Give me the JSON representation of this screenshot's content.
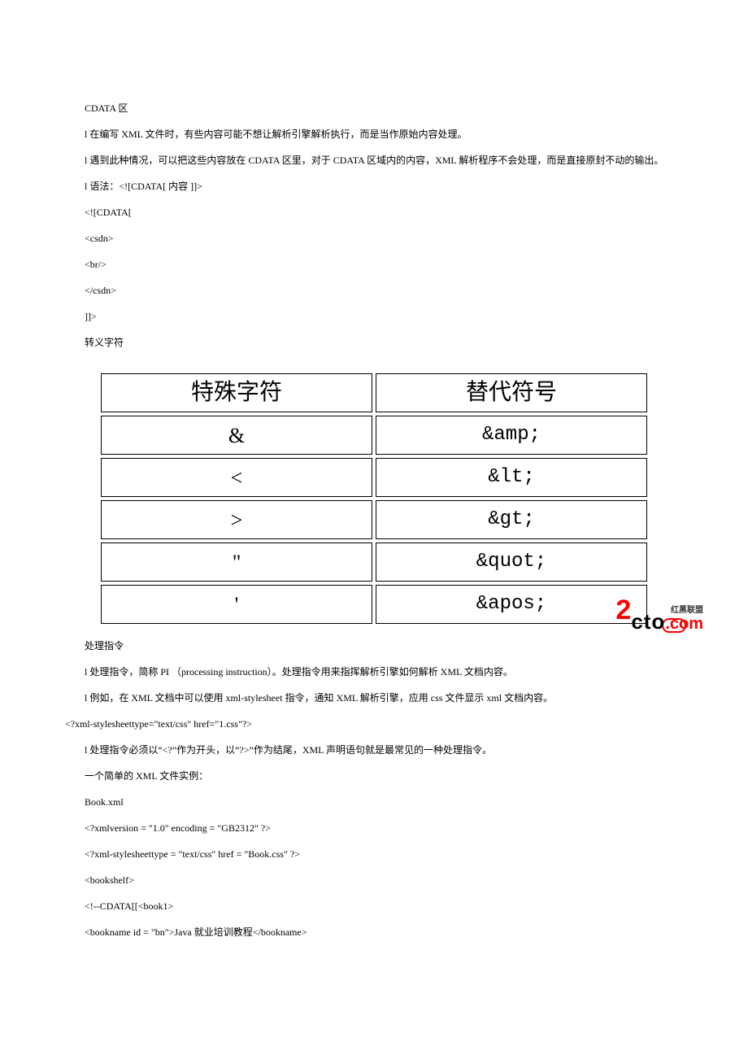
{
  "section1": {
    "title": "CDATA 区",
    "p1": "l 在编写 XML 文件时，有些内容可能不想让解析引擎解析执行，而是当作原始内容处理。",
    "p2": "l 遇到此种情况，可以把这些内容放在 CDATA 区里，对于 CDATA 区域内的内容，XML 解析程序不会处理，而是直接原封不动的输出。",
    "p3": "l 语法：<![CDATA[ 内容 ]]>",
    "code": {
      "l1": "<![CDATA[",
      "l2": "<csdn>",
      "l3": "<br/>",
      "l4": "</csdn>",
      "l5": "]]>"
    }
  },
  "section2": {
    "title": "转义字符"
  },
  "table": {
    "header": {
      "c1": "特殊字符",
      "c2": "替代符号"
    },
    "rows": [
      {
        "c1": "&",
        "c2": "&amp;"
      },
      {
        "c1": "<",
        "c2": "&lt;"
      },
      {
        "c1": ">",
        "c2": "&gt;"
      },
      {
        "c1": "\"",
        "c2": "&quot;"
      },
      {
        "c1": "'",
        "c2": "&apos;"
      }
    ]
  },
  "watermark": {
    "two": "2",
    "cto": "cto",
    "han": "红黑联盟",
    "com": ".com"
  },
  "section3": {
    "title": "处理指令",
    "p1": "l 处理指令，简称 PI （processing instruction）。处理指令用来指挥解析引擎如何解析 XML 文档内容。",
    "p2": "l 例如，在 XML 文档中可以使用 xml-stylesheet 指令，通知 XML 解析引擎，应用 css 文件显示 xml 文档内容。",
    "p2b": "<?xml-stylesheettype=\"text/css\" href=\"1.css\"?>",
    "p3": "l 处理指令必须以“<?”作为开头，以“?>”作为结尾，XML 声明语句就是最常见的一种处理指令。",
    "p4": "一个简单的 XML 文件实例：",
    "p5": "Book.xml",
    "code": {
      "l1": "<?xmlversion = \"1.0\" encoding = \"GB2312\" ?>",
      "l2": "<?xml-stylesheettype = \"text/css\" href = \"Book.css\" ?>",
      "l3": "<bookshelf>",
      "l4": "<!--CDATA[[<book1>",
      "l5": "<bookname id = \"bn\">Java 就业培训教程</bookname>"
    }
  }
}
